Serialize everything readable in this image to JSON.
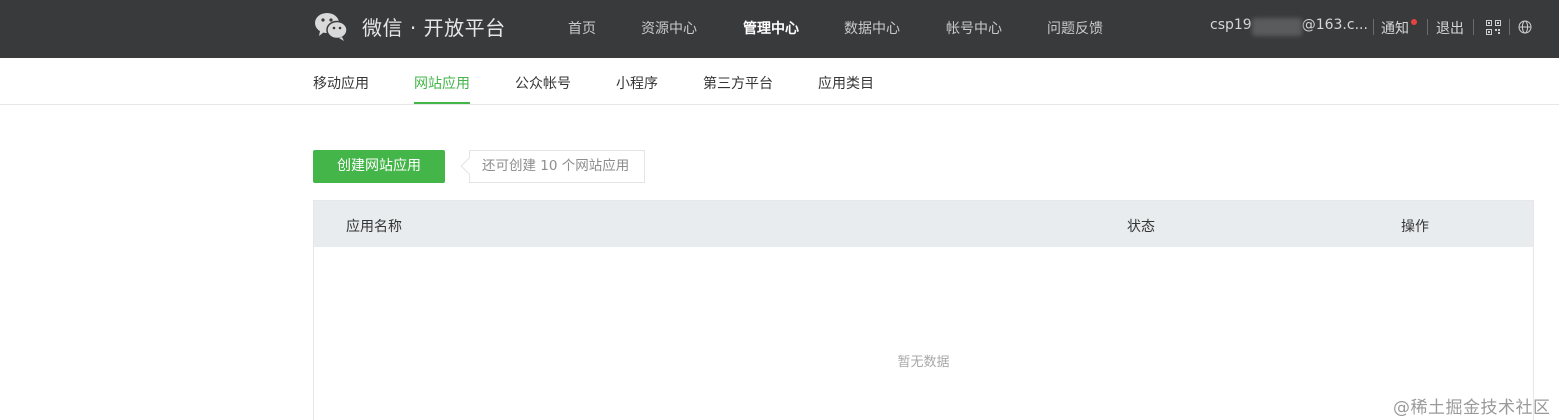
{
  "header": {
    "brand": "微信 · 开放平台",
    "nav": [
      {
        "label": "首页",
        "active": false
      },
      {
        "label": "资源中心",
        "active": false
      },
      {
        "label": "管理中心",
        "active": true
      },
      {
        "label": "数据中心",
        "active": false
      },
      {
        "label": "帐号中心",
        "active": false
      },
      {
        "label": "问题反馈",
        "active": false
      }
    ],
    "account_prefix": "csp19",
    "account_suffix": "@163.c...",
    "notice_label": "通知",
    "logout_label": "退出",
    "icons": [
      "wechat-logo-icon",
      "qrcode-icon",
      "globe-icon"
    ],
    "notice_dot_color": "#e64340"
  },
  "subnav": {
    "items": [
      {
        "label": "移动应用",
        "active": false
      },
      {
        "label": "网站应用",
        "active": true
      },
      {
        "label": "公众帐号",
        "active": false
      },
      {
        "label": "小程序",
        "active": false
      },
      {
        "label": "第三方平台",
        "active": false
      },
      {
        "label": "应用类目",
        "active": false
      }
    ],
    "accent_color": "#44b549"
  },
  "main": {
    "create_button_label": "创建网站应用",
    "quota_tip": "还可创建 10 个网站应用",
    "table": {
      "columns": [
        "应用名称",
        "状态",
        "操作"
      ],
      "rows": [],
      "empty_text": "暂无数据"
    }
  },
  "watermark": "@稀土掘金技术社区"
}
